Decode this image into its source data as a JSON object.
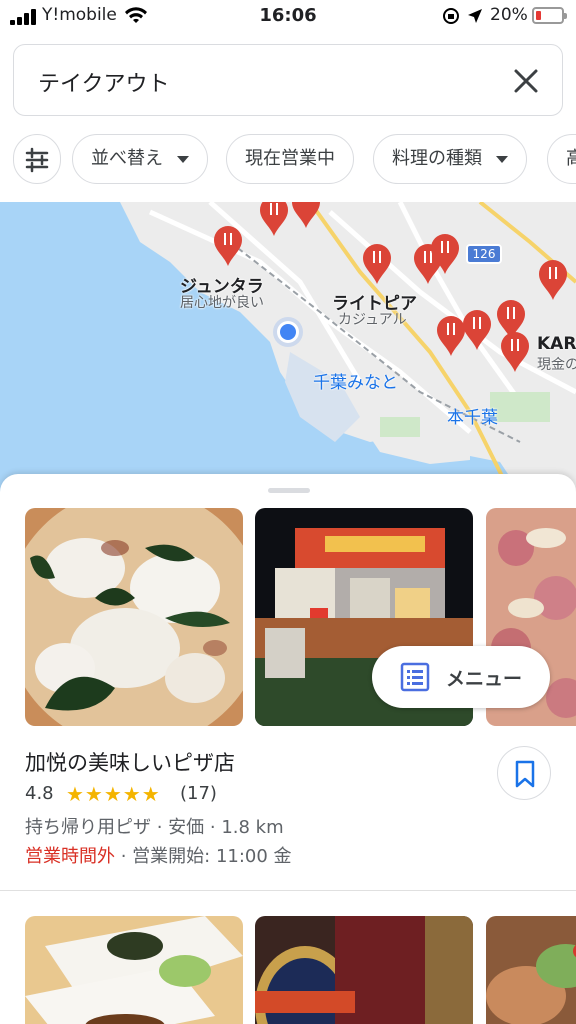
{
  "status_bar": {
    "carrier": "Y!mobile",
    "time": "16:06",
    "battery_percent": "20%",
    "battery_level": 0.2
  },
  "search": {
    "query": "テイクアウト",
    "close_icon": "close-icon"
  },
  "chips": [
    {
      "label": "並べ替え",
      "has_dropdown": true
    },
    {
      "label": "現在営業中",
      "has_dropdown": false
    },
    {
      "label": "料理の種類",
      "has_dropdown": true
    },
    {
      "label": "高",
      "has_dropdown": false
    }
  ],
  "map": {
    "labels": {
      "place1_name": "ジュンタラ",
      "place1_sub": "居心地が良い",
      "place2_name": "ライトピア",
      "place2_sub": "カジュアル",
      "place3_name": "KAR",
      "place3_sub": "現金の",
      "station1": "千葉みなと",
      "station2": "本千葉",
      "route": "126"
    },
    "colors": {
      "water": "#a8d4f7",
      "land": "#eaeaea",
      "pin": "#db4437",
      "location": "#4285f4"
    }
  },
  "result": {
    "menu_label": "メニュー",
    "name": "加悦の美味しいピザ店",
    "rating": "4.8",
    "stars": "★★★★★",
    "reviews": "(17)",
    "meta": "持ち帰り用ピザ · 安価 · 1.8 km",
    "closed_label": "営業時間外",
    "opens": " · 営業開始: 11:00 金"
  },
  "accent_colors": {
    "closed": "#d93025",
    "star": "#f4b400",
    "link": "#1a73e8"
  }
}
